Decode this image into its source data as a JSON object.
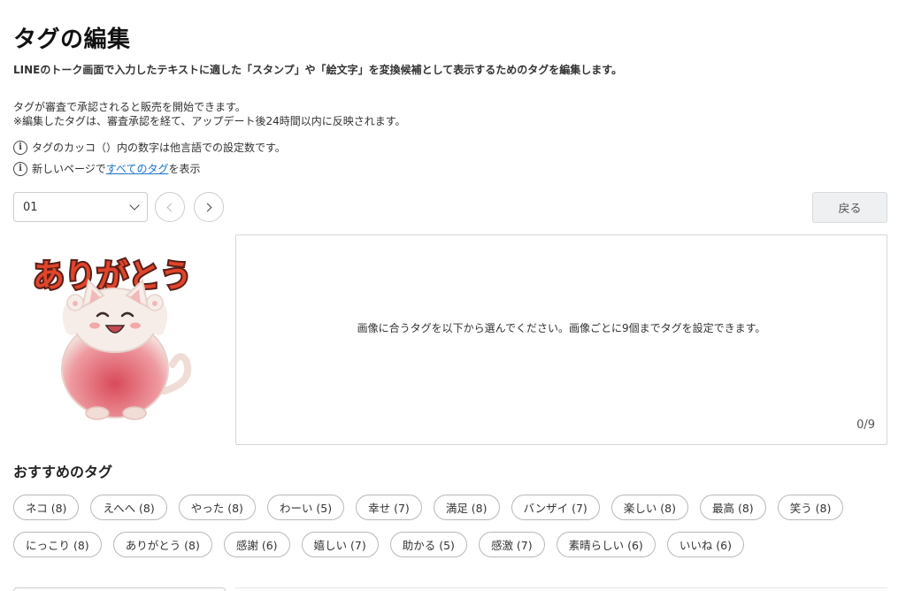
{
  "header": {
    "title": "タグの編集",
    "lead": "LINEのトーク画面で入力したテキストに適した「スタンプ」や「絵文字」を変換候補として表示するためのタグを編集します。"
  },
  "notice": {
    "line1": "タグが審査で承認されると販売を開始できます。",
    "line2": "※編集したタグは、審査承認を経て、アップデート後24時間以内に反映されます。"
  },
  "info": {
    "line1": "タグのカッコ（）内の数字は他言語での設定数です。",
    "line2_prefix": "新しいページで",
    "line2_link": "すべてのタグ",
    "line2_suffix": "を表示",
    "icon": "info-circle-icon"
  },
  "controls": {
    "select_value": "01",
    "back_label": "戻る"
  },
  "sticker": {
    "text": "ありがとう"
  },
  "tag_box": {
    "hint": "画像に合うタグを以下から選んでください。画像ごとに9個までタグを設定できます。",
    "count": "0/9"
  },
  "recommended": {
    "title": "おすすめのタグ",
    "rows": [
      [
        "ネコ (8)",
        "えへへ (8)",
        "やった (8)",
        "わーい (5)",
        "幸せ (7)",
        "満足 (8)",
        "バンザイ (7)",
        "楽しい (8)",
        "最高 (8)",
        "笑う (8)"
      ],
      [
        "にっこり (8)",
        "ありがとう (8)",
        "感謝 (6)",
        "嬉しい (7)",
        "助かる (5)",
        "感激 (7)",
        "素晴らしい (6)",
        "いいね (6)"
      ]
    ]
  },
  "colors": {
    "link": "#1a73c9",
    "sticker_text_fill": "#e0452a",
    "sticker_text_outline": "#5a1f1a",
    "cat_body": "#f3e7e2",
    "cat_belly": "#d94a5a"
  }
}
